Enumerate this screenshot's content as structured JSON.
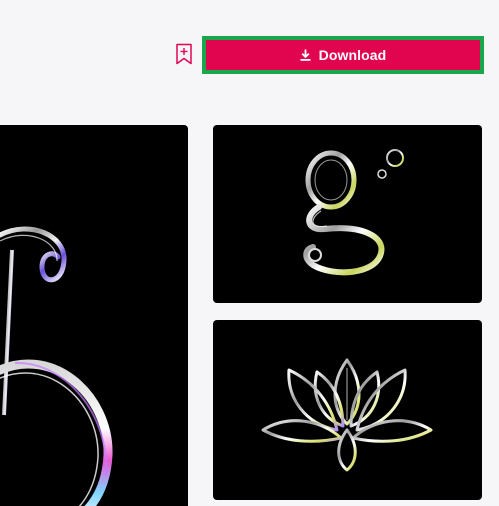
{
  "toolbar": {
    "bookmark_icon": "bookmark-add-icon",
    "download_label": "Download",
    "download_icon": "download-icon",
    "colors": {
      "download_bg": "#e0054e",
      "download_outline": "#1aa64a",
      "bookmark_stroke": "#e0054e",
      "page_bg": "#f6f6f9"
    }
  },
  "gallery": {
    "items": [
      {
        "subject": "chrome-number-5"
      },
      {
        "subject": "chrome-letter-g"
      },
      {
        "subject": "chrome-lotus"
      }
    ]
  }
}
